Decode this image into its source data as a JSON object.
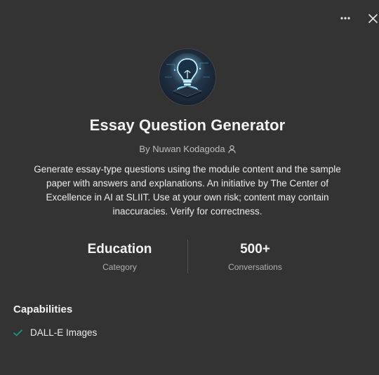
{
  "header": {
    "more_icon": "ellipsis-icon",
    "close_icon": "close-icon"
  },
  "gpt": {
    "avatar_icon": "lightbulb-icon",
    "title": "Essay Question Generator",
    "byline": "By Nuwan Kodagoda",
    "byline_icon": "person-icon",
    "description": "Generate essay-type questions using the module content and the sample paper with answers and explanations. An initiative by The Center of Excellence in AI at SLIIT. Use at your own risk; content may contain inaccuracies. Verify for correctness."
  },
  "stats": [
    {
      "value": "Education",
      "label": "Category"
    },
    {
      "value": "500+",
      "label": "Conversations"
    }
  ],
  "capabilities": {
    "heading": "Capabilities",
    "items": [
      {
        "label": "DALL-E Images",
        "icon": "check-icon"
      }
    ]
  },
  "colors": {
    "background": "#333333",
    "text": "#ececec",
    "muted": "#b0b0b0",
    "check": "#10a37f",
    "bulb_glow": "#7fd6ff"
  }
}
